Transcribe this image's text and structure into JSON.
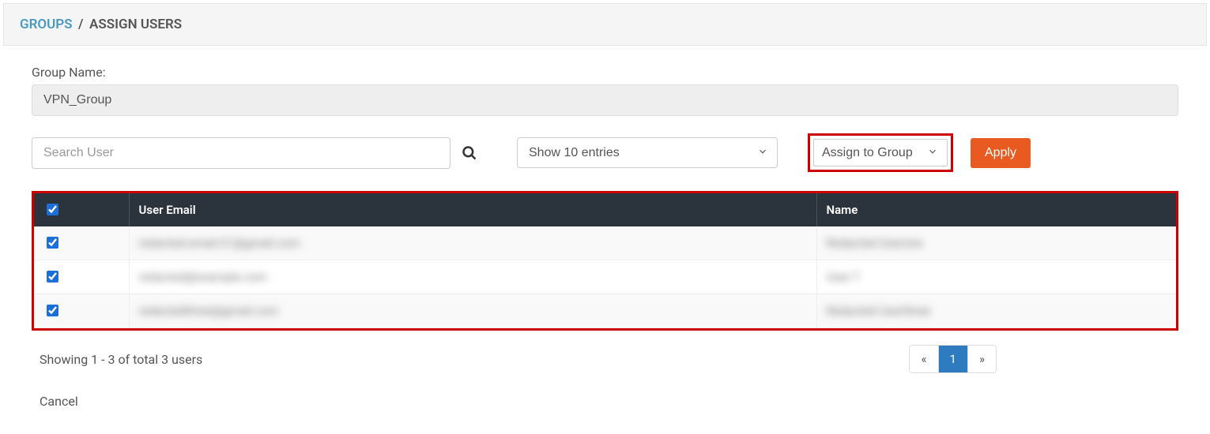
{
  "breadcrumb": {
    "groups": "GROUPS",
    "sep": "/",
    "current": "ASSIGN USERS"
  },
  "form": {
    "groupNameLabel": "Group Name:",
    "groupNameValue": "VPN_Group",
    "searchPlaceholder": "Search User",
    "entriesLabel": "Show 10 entries",
    "assignLabel": "Assign to Group",
    "applyLabel": "Apply"
  },
  "table": {
    "headers": {
      "email": "User Email",
      "name": "Name"
    },
    "rows": [
      {
        "checked": true,
        "email": "redacted.email.01@gmail.com",
        "name": "Redacted Userone"
      },
      {
        "checked": true,
        "email": "redacted@example.com",
        "name": "User T"
      },
      {
        "checked": true,
        "email": "redactedthree@gmail.com",
        "name": "Redacted Userthree"
      }
    ]
  },
  "footer": {
    "showing": "Showing 1 - 3 of total 3 users",
    "prev": "«",
    "page": "1",
    "next": "»",
    "cancel": "Cancel"
  }
}
